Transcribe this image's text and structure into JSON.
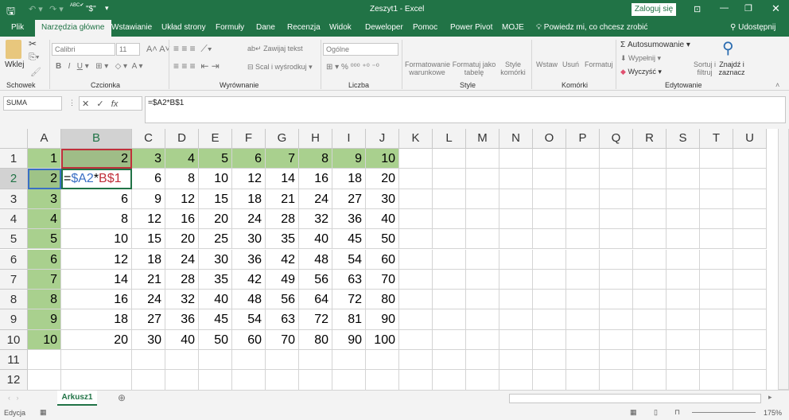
{
  "title": "Zeszyt1  -  Excel",
  "qat": {
    "abc": "ABC",
    "dollar": "\"$\""
  },
  "login": "Zaloguj się",
  "tabs": [
    "Plik",
    "Narzędzia główne",
    "Wstawianie",
    "Układ strony",
    "Formuły",
    "Dane",
    "Recenzja",
    "Widok",
    "Deweloper",
    "Pomoc",
    "Power Pivot",
    "MOJE"
  ],
  "tell_me": "Powiedz mi, co chcesz zrobić",
  "share": "Udostępnij",
  "ribbon": {
    "paste": "Wklej",
    "font": "Calibri",
    "size": "11",
    "wrap": "Zawijaj tekst",
    "merge": "Scal i wyśrodkuj",
    "number_format": "Ogólne",
    "cond": "Formatowanie warunkowe",
    "as_table": "Formatuj jako tabelę",
    "cell_styles": "Style komórki",
    "insert": "Wstaw",
    "delete": "Usuń",
    "format": "Formatuj",
    "autosum": "Autosumowanie",
    "fill": "Wypełnij",
    "clear": "Wyczyść",
    "sort": "Sortuj i filtruj",
    "find": "Znajdź i zaznacz",
    "groups": [
      "Schowek",
      "Czcionka",
      "Wyrównanie",
      "Liczba",
      "Style",
      "Komórki",
      "Edytowanie"
    ]
  },
  "name_box": "SUMA",
  "formula": "=$A2*B$1",
  "edit_cell": {
    "eq": "=",
    "ref1": "$A2",
    "op": "*",
    "ref2": "B$1"
  },
  "columns": [
    "A",
    "B",
    "C",
    "D",
    "E",
    "F",
    "G",
    "H",
    "I",
    "J",
    "K",
    "L",
    "M",
    "N",
    "O",
    "P",
    "Q",
    "R",
    "S",
    "T",
    "U"
  ],
  "rows": [
    [
      1,
      2,
      3,
      4,
      5,
      6,
      7,
      8,
      9,
      10
    ],
    [
      2,
      null,
      6,
      8,
      10,
      12,
      14,
      16,
      18,
      20
    ],
    [
      3,
      6,
      9,
      12,
      15,
      18,
      21,
      24,
      27,
      30
    ],
    [
      4,
      8,
      12,
      16,
      20,
      24,
      28,
      32,
      36,
      40
    ],
    [
      5,
      10,
      15,
      20,
      25,
      30,
      35,
      40,
      45,
      50
    ],
    [
      6,
      12,
      18,
      24,
      30,
      36,
      42,
      48,
      54,
      60
    ],
    [
      7,
      14,
      21,
      28,
      35,
      42,
      49,
      56,
      63,
      70
    ],
    [
      8,
      16,
      24,
      32,
      40,
      48,
      56,
      64,
      72,
      80
    ],
    [
      9,
      18,
      27,
      36,
      45,
      54,
      63,
      72,
      81,
      90
    ],
    [
      10,
      20,
      30,
      40,
      50,
      60,
      70,
      80,
      90,
      100
    ],
    [],
    []
  ],
  "colors": {
    "green": "#217346",
    "fill": "#a9d08e",
    "ref1": "#3a6fc4",
    "ref2": "#c0303a"
  },
  "sheet": "Arkusz1",
  "status": "Edycja",
  "zoom": "175%"
}
